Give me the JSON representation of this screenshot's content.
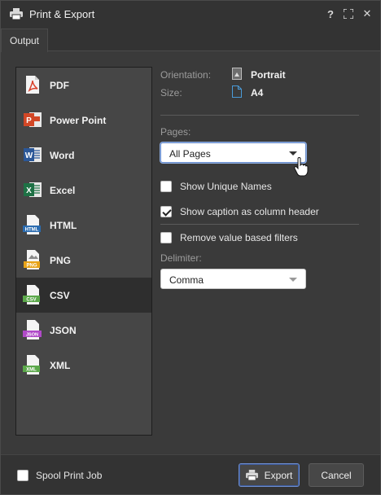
{
  "window": {
    "title": "Print & Export",
    "help_label": "?",
    "close_label": "✕"
  },
  "tabs": [
    {
      "label": "Output",
      "selected": true
    }
  ],
  "formats": [
    {
      "label": "PDF",
      "icon": "pdf-icon",
      "color": "#d9412b"
    },
    {
      "label": "Power Point",
      "icon": "powerpoint-icon",
      "color": "#d24726"
    },
    {
      "label": "Word",
      "icon": "word-icon",
      "color": "#2b5797"
    },
    {
      "label": "Excel",
      "icon": "excel-icon",
      "color": "#1e7145"
    },
    {
      "label": "HTML",
      "icon": "html-icon",
      "badge": "HTML",
      "color": "#2b6cb0"
    },
    {
      "label": "PNG",
      "icon": "png-icon",
      "badge": "PNG",
      "color": "#e8a317"
    },
    {
      "label": "CSV",
      "icon": "csv-icon",
      "badge": "CSV",
      "color": "#5ba84a",
      "selected": true
    },
    {
      "label": "JSON",
      "icon": "json-icon",
      "badge": "JSON",
      "color": "#b04ac8"
    },
    {
      "label": "XML",
      "icon": "xml-icon",
      "badge": "XML",
      "color": "#5ba84a"
    }
  ],
  "page": {
    "orientation_label": "Orientation:",
    "orientation_value": "Portrait",
    "size_label": "Size:",
    "size_value": "A4"
  },
  "pages": {
    "label": "Pages:",
    "value": "All Pages"
  },
  "options": {
    "show_unique_names": {
      "label": "Show Unique Names",
      "checked": false
    },
    "show_caption": {
      "label": "Show caption as column header",
      "checked": true
    },
    "remove_value_filters": {
      "label": "Remove value based filters",
      "checked": false
    }
  },
  "delimiter": {
    "label": "Delimiter:",
    "value": "Comma"
  },
  "footer": {
    "spool_label": "Spool Print Job",
    "spool_checked": false,
    "export_label": "Export",
    "cancel_label": "Cancel"
  },
  "colors": {
    "accent": "#6f8fd0",
    "background": "#3a3a3a"
  }
}
